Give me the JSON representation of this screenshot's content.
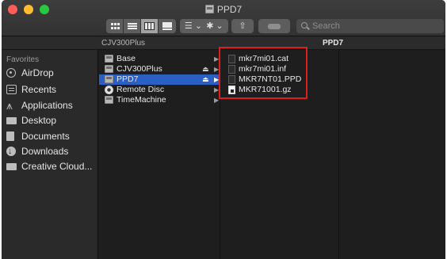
{
  "window": {
    "title": "PPD7"
  },
  "toolbar": {
    "back_label": "〈",
    "forward_label": "〉",
    "group_label": "☰ ⌄",
    "action_label": "✱ ⌄",
    "share_label": "⇧",
    "tags_label": "",
    "search_placeholder": "Search"
  },
  "pathbar": {
    "crumb_1": "CJV300Plus",
    "crumb_2": "PPD7"
  },
  "sidebar": {
    "heading": "Favorites",
    "items": [
      {
        "label": "AirDrop",
        "icon": "airdrop-icon"
      },
      {
        "label": "Recents",
        "icon": "recents-icon"
      },
      {
        "label": "Applications",
        "icon": "applications-icon"
      },
      {
        "label": "Desktop",
        "icon": "desktop-icon"
      },
      {
        "label": "Documents",
        "icon": "documents-icon"
      },
      {
        "label": "Downloads",
        "icon": "downloads-icon"
      },
      {
        "label": "Creative Cloud...",
        "icon": "folder-icon"
      }
    ]
  },
  "column1": {
    "items": [
      {
        "label": "Base",
        "icon": "disk-icon",
        "eject": "",
        "chevron": "▶"
      },
      {
        "label": "CJV300Plus",
        "icon": "disk-icon",
        "eject": "⏏",
        "chevron": "▶"
      },
      {
        "label": "PPD7",
        "icon": "disk-icon",
        "eject": "⏏",
        "chevron": "▶",
        "selected": true
      },
      {
        "label": "Remote Disc",
        "icon": "cd-icon",
        "eject": "",
        "chevron": "▶"
      },
      {
        "label": "TimeMachine",
        "icon": "disk-icon",
        "eject": "",
        "chevron": "▶"
      }
    ]
  },
  "column2": {
    "items": [
      {
        "label": "mkr7mi01.cat",
        "icon": "file-icon"
      },
      {
        "label": "mkr7mi01.inf",
        "icon": "file-icon"
      },
      {
        "label": "MKR7NT01.PPD",
        "icon": "file-icon"
      },
      {
        "label": "MKR71001.gz",
        "icon": "document-icon"
      }
    ]
  },
  "colors": {
    "selection": "#2c5fc3",
    "highlight_box": "#d92020"
  }
}
